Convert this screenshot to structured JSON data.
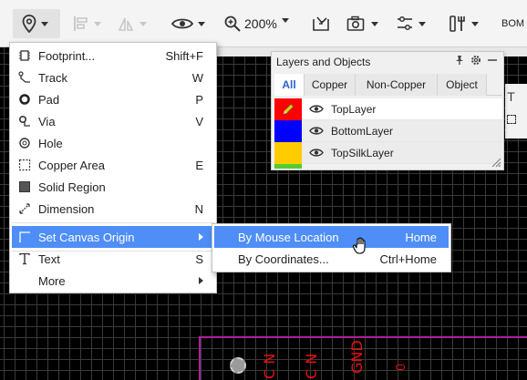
{
  "toolbar": {
    "zoom_value": "200%",
    "bom_label": "BOM",
    "icons": [
      "map-pin-icon",
      "align-icon",
      "flip-icon",
      "eye-icon",
      "zoom-icon",
      "import-icon",
      "camera-icon",
      "share-icon",
      "tools-icon"
    ]
  },
  "menu": {
    "items": [
      {
        "label": "Footprint...",
        "shortcut": "Shift+F",
        "icon": "footprint-icon"
      },
      {
        "label": "Track",
        "shortcut": "W",
        "icon": "track-icon"
      },
      {
        "label": "Pad",
        "shortcut": "P",
        "icon": "pad-icon"
      },
      {
        "label": "Via",
        "shortcut": "V",
        "icon": "via-icon"
      },
      {
        "label": "Hole",
        "shortcut": "",
        "icon": "hole-icon"
      },
      {
        "label": "Copper Area",
        "shortcut": "E",
        "icon": "copper-area-icon"
      },
      {
        "label": "Solid Region",
        "shortcut": "",
        "icon": "solid-region-icon"
      },
      {
        "label": "Dimension",
        "shortcut": "N",
        "icon": "dimension-icon"
      },
      {
        "label": "Set Canvas Origin",
        "shortcut": "",
        "icon": "canvas-origin-icon"
      },
      {
        "label": "Text",
        "shortcut": "S",
        "icon": "text-icon"
      },
      {
        "label": "More",
        "shortcut": "",
        "icon": ""
      }
    ]
  },
  "submenu": {
    "items": [
      {
        "label": "By Mouse Location",
        "shortcut": "Home"
      },
      {
        "label": "By Coordinates...",
        "shortcut": "Ctrl+Home"
      }
    ]
  },
  "layers_panel": {
    "title": "Layers and Objects",
    "tabs": [
      "All",
      "Copper",
      "Non-Copper",
      "Object"
    ],
    "active_tab": "All",
    "layers": [
      {
        "name": "TopLayer",
        "color": "#ff0000"
      },
      {
        "name": "BottomLayer",
        "color": "#0000ff"
      },
      {
        "name": "TopSilkLayer",
        "color": "#ffcc00"
      }
    ]
  },
  "canvas": {
    "labels": [
      "C N",
      "C N",
      "GND"
    ]
  },
  "colors": {
    "highlight": "#4f8ef7",
    "grid": "#3a3a3a",
    "board_outline": "#b0209a",
    "silk_text": "#e81010"
  }
}
